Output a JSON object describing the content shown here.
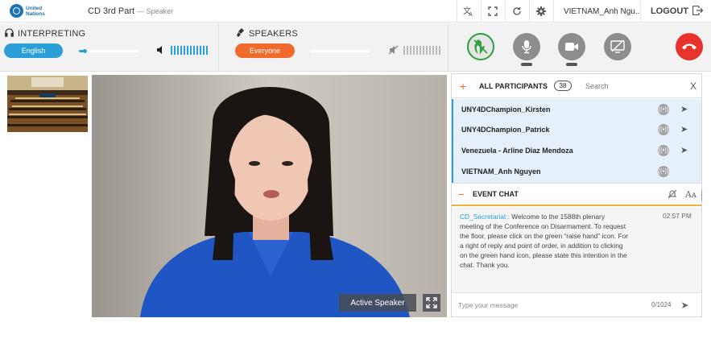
{
  "topbar": {
    "org_name": "United Nations",
    "meeting_title": "CD 3rd Part",
    "meeting_role": "— Speaker",
    "user_name": "VIETNAM_Anh Ngu...",
    "logout_label": "LOGOUT"
  },
  "controls": {
    "interpreting_label": "INTERPRETING",
    "language": "English",
    "interpreting_volume": 0.1,
    "speakers_label": "SPEAKERS",
    "speakers_mode": "Everyone",
    "speakers_volume": 0.0
  },
  "participants": {
    "title": "ALL PARTICIPANTS",
    "count": "38",
    "search_placeholder": "Search",
    "close_label": "X",
    "items": [
      {
        "name": "UNY4DChampion_Kirsten",
        "send": true
      },
      {
        "name": "UNY4DChampion_Patrick",
        "send": true
      },
      {
        "name": "Venezuela - Arline Diaz Mendoza",
        "send": true
      },
      {
        "name": "VIETNAM_Anh Nguyen",
        "send": false
      }
    ]
  },
  "chat": {
    "title": "EVENT CHAT",
    "sender": "CD_Secretariat :",
    "message": "Welcome to the 1588th plenary meeting of the Conference on Disarmament. To request the floor, please click on the green “raise hand” icon. For a right of reply and point of order, in addition to clicking on the green hand icon, please state this intention in the chat. Thank you.",
    "time": "02:57 PM",
    "input_placeholder": "Type your message",
    "char_count": "0/1024"
  },
  "video": {
    "active_speaker_label": "Active Speaker"
  },
  "colors": {
    "accent_blue": "#2a9fd8",
    "accent_orange": "#f06a2c",
    "hand_green": "#2e9e3e",
    "hangup_red": "#e8322c"
  }
}
